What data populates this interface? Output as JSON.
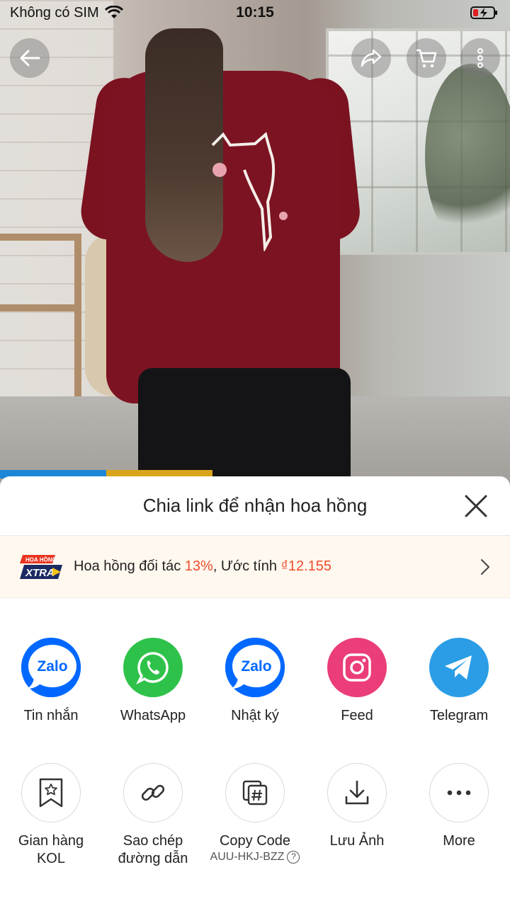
{
  "status_bar": {
    "carrier": "Không có SIM",
    "time": "10:15"
  },
  "top_bar": {
    "icons": [
      "back-arrow-icon",
      "share-icon",
      "cart-icon",
      "more-vertical-icon"
    ]
  },
  "sheet": {
    "title": "Chia link để nhận hoa hồng",
    "banner": {
      "logo_line1": "HOA HỒNG",
      "logo_line2": "XTRA",
      "text_prefix": "Hoa hồng đối tác ",
      "commission_rate": "13%",
      "text_middle": ", Ước tính ",
      "estimate": "₫12.155"
    },
    "apps": [
      {
        "label": "Tin nhắn",
        "icon": "zalo-icon",
        "color": "#0068ff",
        "logo": "Zalo"
      },
      {
        "label": "WhatsApp",
        "icon": "whatsapp-icon",
        "color": "#2fc24a"
      },
      {
        "label": "Nhật ký",
        "icon": "zalo-icon",
        "color": "#0068ff",
        "logo": "Zalo"
      },
      {
        "label": "Feed",
        "icon": "instagram-icon",
        "color": "#ea3d79"
      },
      {
        "label": "Telegram",
        "icon": "telegram-icon",
        "color": "#2a9de6"
      }
    ],
    "tools": [
      {
        "label_line1": "Gian hàng",
        "label_line2": "KOL",
        "icon": "bookmark-star-icon"
      },
      {
        "label_line1": "Sao chép",
        "label_line2": "đường dẫn",
        "icon": "link-icon"
      },
      {
        "label_line1": "Copy Code",
        "code": "AUU-HKJ-BZZ",
        "icon": "copy-code-icon"
      },
      {
        "label_line1": "Lưu Ảnh",
        "icon": "download-icon"
      },
      {
        "label_line1": "More",
        "icon": "more-horizontal-icon"
      }
    ]
  }
}
